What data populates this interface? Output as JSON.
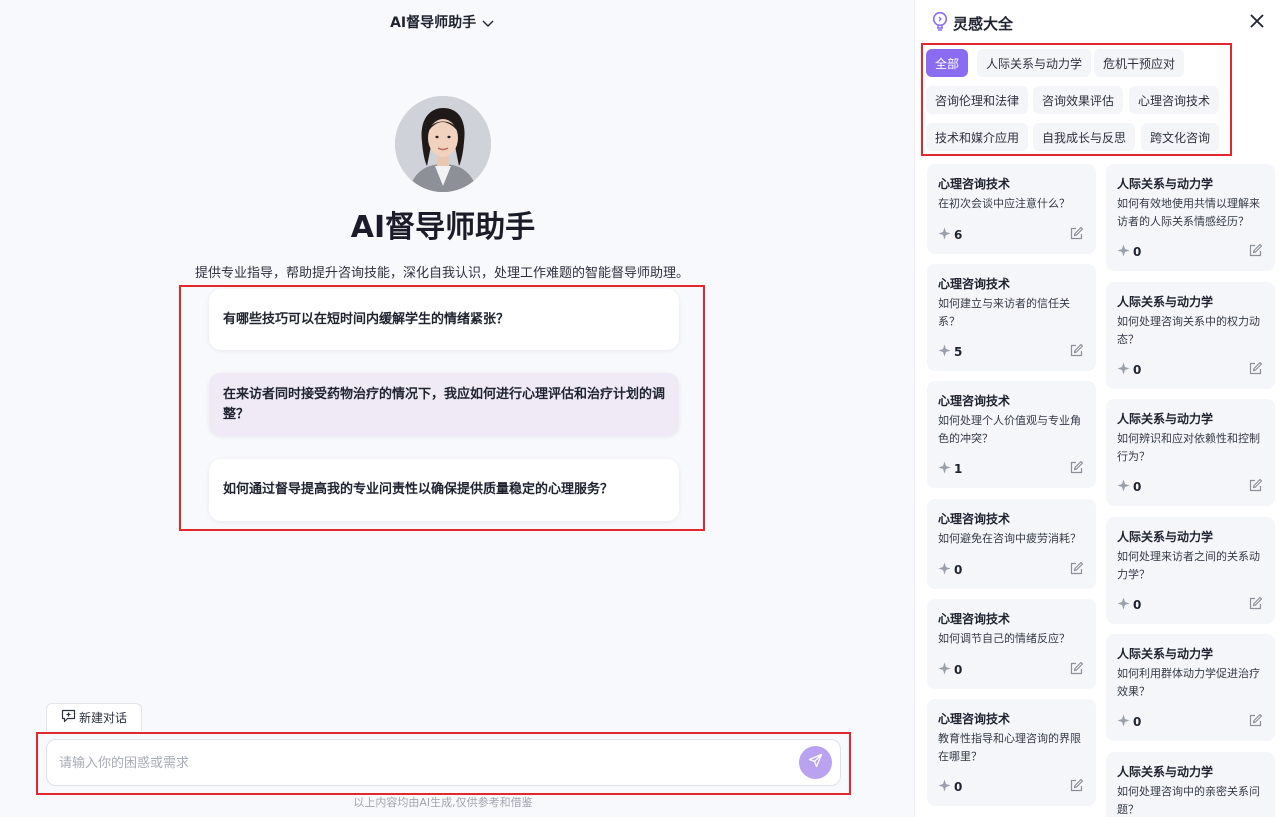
{
  "header": {
    "title": "AI督导师助手"
  },
  "hero": {
    "title": "AI督导师助手",
    "description": "提供专业指导，帮助提升咨询技能，深化自我认识，处理工作难题的智能督导师助理。"
  },
  "suggestions": [
    "有哪些技巧可以在短时间内缓解学生的情绪紧张？",
    "在来访者同时接受药物治疗的情况下，我应如何进行心理评估和治疗计划的调整？",
    "如何通过督导提高我的专业问责性以确保提供质量稳定的心理服务？"
  ],
  "composer": {
    "new_chat_label": "新建对话",
    "placeholder": "请输入你的困惑或需求",
    "footnote": "以上内容均由AI生成,仅供参考和借鉴"
  },
  "panel": {
    "title": "灵感大全",
    "tags": [
      "全部",
      "人际关系与动力学",
      "危机干预应对",
      "咨询伦理和法律",
      "咨询效果评估",
      "心理咨询技术",
      "技术和媒介应用",
      "自我成长与反思",
      "跨文化咨询"
    ],
    "active_tag": "全部",
    "cards_left": [
      {
        "category": "心理咨询技术",
        "question": "在初次会谈中应注意什么？",
        "count": "6"
      },
      {
        "category": "心理咨询技术",
        "question": "如何建立与来访者的信任关系？",
        "count": "5"
      },
      {
        "category": "心理咨询技术",
        "question": "如何处理个人价值观与专业角色的冲突？",
        "count": "1"
      },
      {
        "category": "心理咨询技术",
        "question": "如何避免在咨询中疲劳消耗？",
        "count": "0"
      },
      {
        "category": "心理咨询技术",
        "question": "如何调节自己的情绪反应？",
        "count": "0"
      },
      {
        "category": "心理咨询技术",
        "question": "教育性指导和心理咨询的界限在哪里？",
        "count": "0"
      }
    ],
    "cards_right": [
      {
        "category": "人际关系与动力学",
        "question": "如何有效地使用共情以理解来访者的人际关系情感经历？",
        "count": "0"
      },
      {
        "category": "人际关系与动力学",
        "question": "如何处理咨询关系中的权力动态？",
        "count": "0"
      },
      {
        "category": "人际关系与动力学",
        "question": "如何辨识和应对依赖性和控制行为？",
        "count": "0"
      },
      {
        "category": "人际关系与动力学",
        "question": "如何处理来访者之间的关系动力学？",
        "count": "0"
      },
      {
        "category": "人际关系与动力学",
        "question": "如何利用群体动力学促进治疗效果？",
        "count": "0"
      },
      {
        "category": "人际关系与动力学",
        "question": "如何处理咨询中的亲密关系问题？",
        "count": ""
      }
    ]
  },
  "colors": {
    "accent": "#8a6cf0",
    "highlight_border": "#e0282e",
    "hover_bg": "#efeaf6"
  },
  "icons": [
    "chevron-down-icon",
    "chat-plus-icon",
    "send-icon",
    "bulb-icon",
    "close-icon",
    "sparkle-icon",
    "edit-icon"
  ]
}
